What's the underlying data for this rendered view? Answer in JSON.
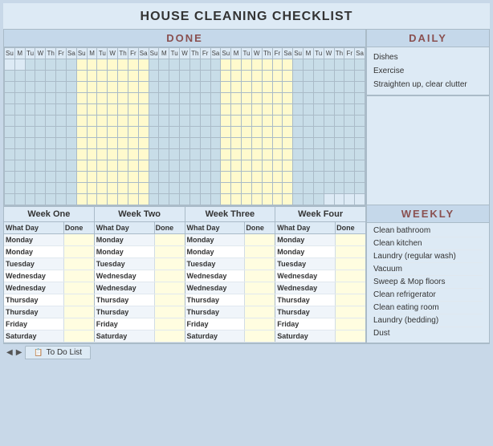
{
  "title": "HOUSE CLEANING CHECKLIST",
  "done_label": "DONE",
  "daily_label": "DAILY",
  "weekly_label": "WEEKLY",
  "daily_items": [
    "Dishes",
    "Exercise",
    "Straighten up, clear clutter"
  ],
  "weekly_items": [
    "Clean bathroom",
    "Clean kitchen",
    "Laundry (regular wash)",
    "Vacuum",
    "Sweep & Mop floors",
    "Clean refrigerator",
    "Clean eating room",
    "Laundry (bedding)",
    "Dust"
  ],
  "weeks": [
    {
      "label": "Week One"
    },
    {
      "label": "Week Two"
    },
    {
      "label": "Week Three"
    },
    {
      "label": "Week Four"
    }
  ],
  "subheaders": [
    {
      "day": "What Day",
      "done": "Done"
    },
    {
      "day": "What Day",
      "done": "Done"
    },
    {
      "day": "What Day",
      "done": "Done"
    },
    {
      "day": "What Day",
      "done": "Done"
    }
  ],
  "schedule_rows": [
    {
      "days": [
        "Monday",
        "Monday",
        "Monday",
        "Monday"
      ]
    },
    {
      "days": [
        "Monday",
        "Monday",
        "Monday",
        "Monday"
      ]
    },
    {
      "days": [
        "Tuesday",
        "Tuesday",
        "Tuesday",
        "Tuesday"
      ]
    },
    {
      "days": [
        "Wednesday",
        "Wednesday",
        "Wednesday",
        "Wednesday"
      ]
    },
    {
      "days": [
        "Wednesday",
        "Wednesday",
        "Wednesday",
        "Wednesday"
      ]
    },
    {
      "days": [
        "Thursday",
        "Thursday",
        "Thursday",
        "Thursday"
      ]
    },
    {
      "days": [
        "Thursday",
        "Thursday",
        "Thursday",
        "Thursday"
      ]
    },
    {
      "days": [
        "Friday",
        "Friday",
        "Friday",
        "Friday"
      ]
    },
    {
      "days": [
        "Saturday",
        "Saturday",
        "Saturday",
        "Saturday"
      ]
    }
  ],
  "tab": {
    "label": "To Do List",
    "icon": "📋"
  },
  "cal_headers": [
    "Su",
    "M",
    "Tu",
    "W",
    "Th",
    "Fr",
    "Sa",
    "Su",
    "M",
    "Tu",
    "W",
    "Th",
    "Fr",
    "Sa",
    "Su",
    "M",
    "Tu",
    "W",
    "Th",
    "Fr",
    "Sa",
    "Su",
    "M",
    "Tu",
    "W",
    "Th",
    "Fr",
    "Sa",
    "Su",
    "M",
    "Tu",
    "W",
    "Th",
    "Fr",
    "Sa"
  ]
}
